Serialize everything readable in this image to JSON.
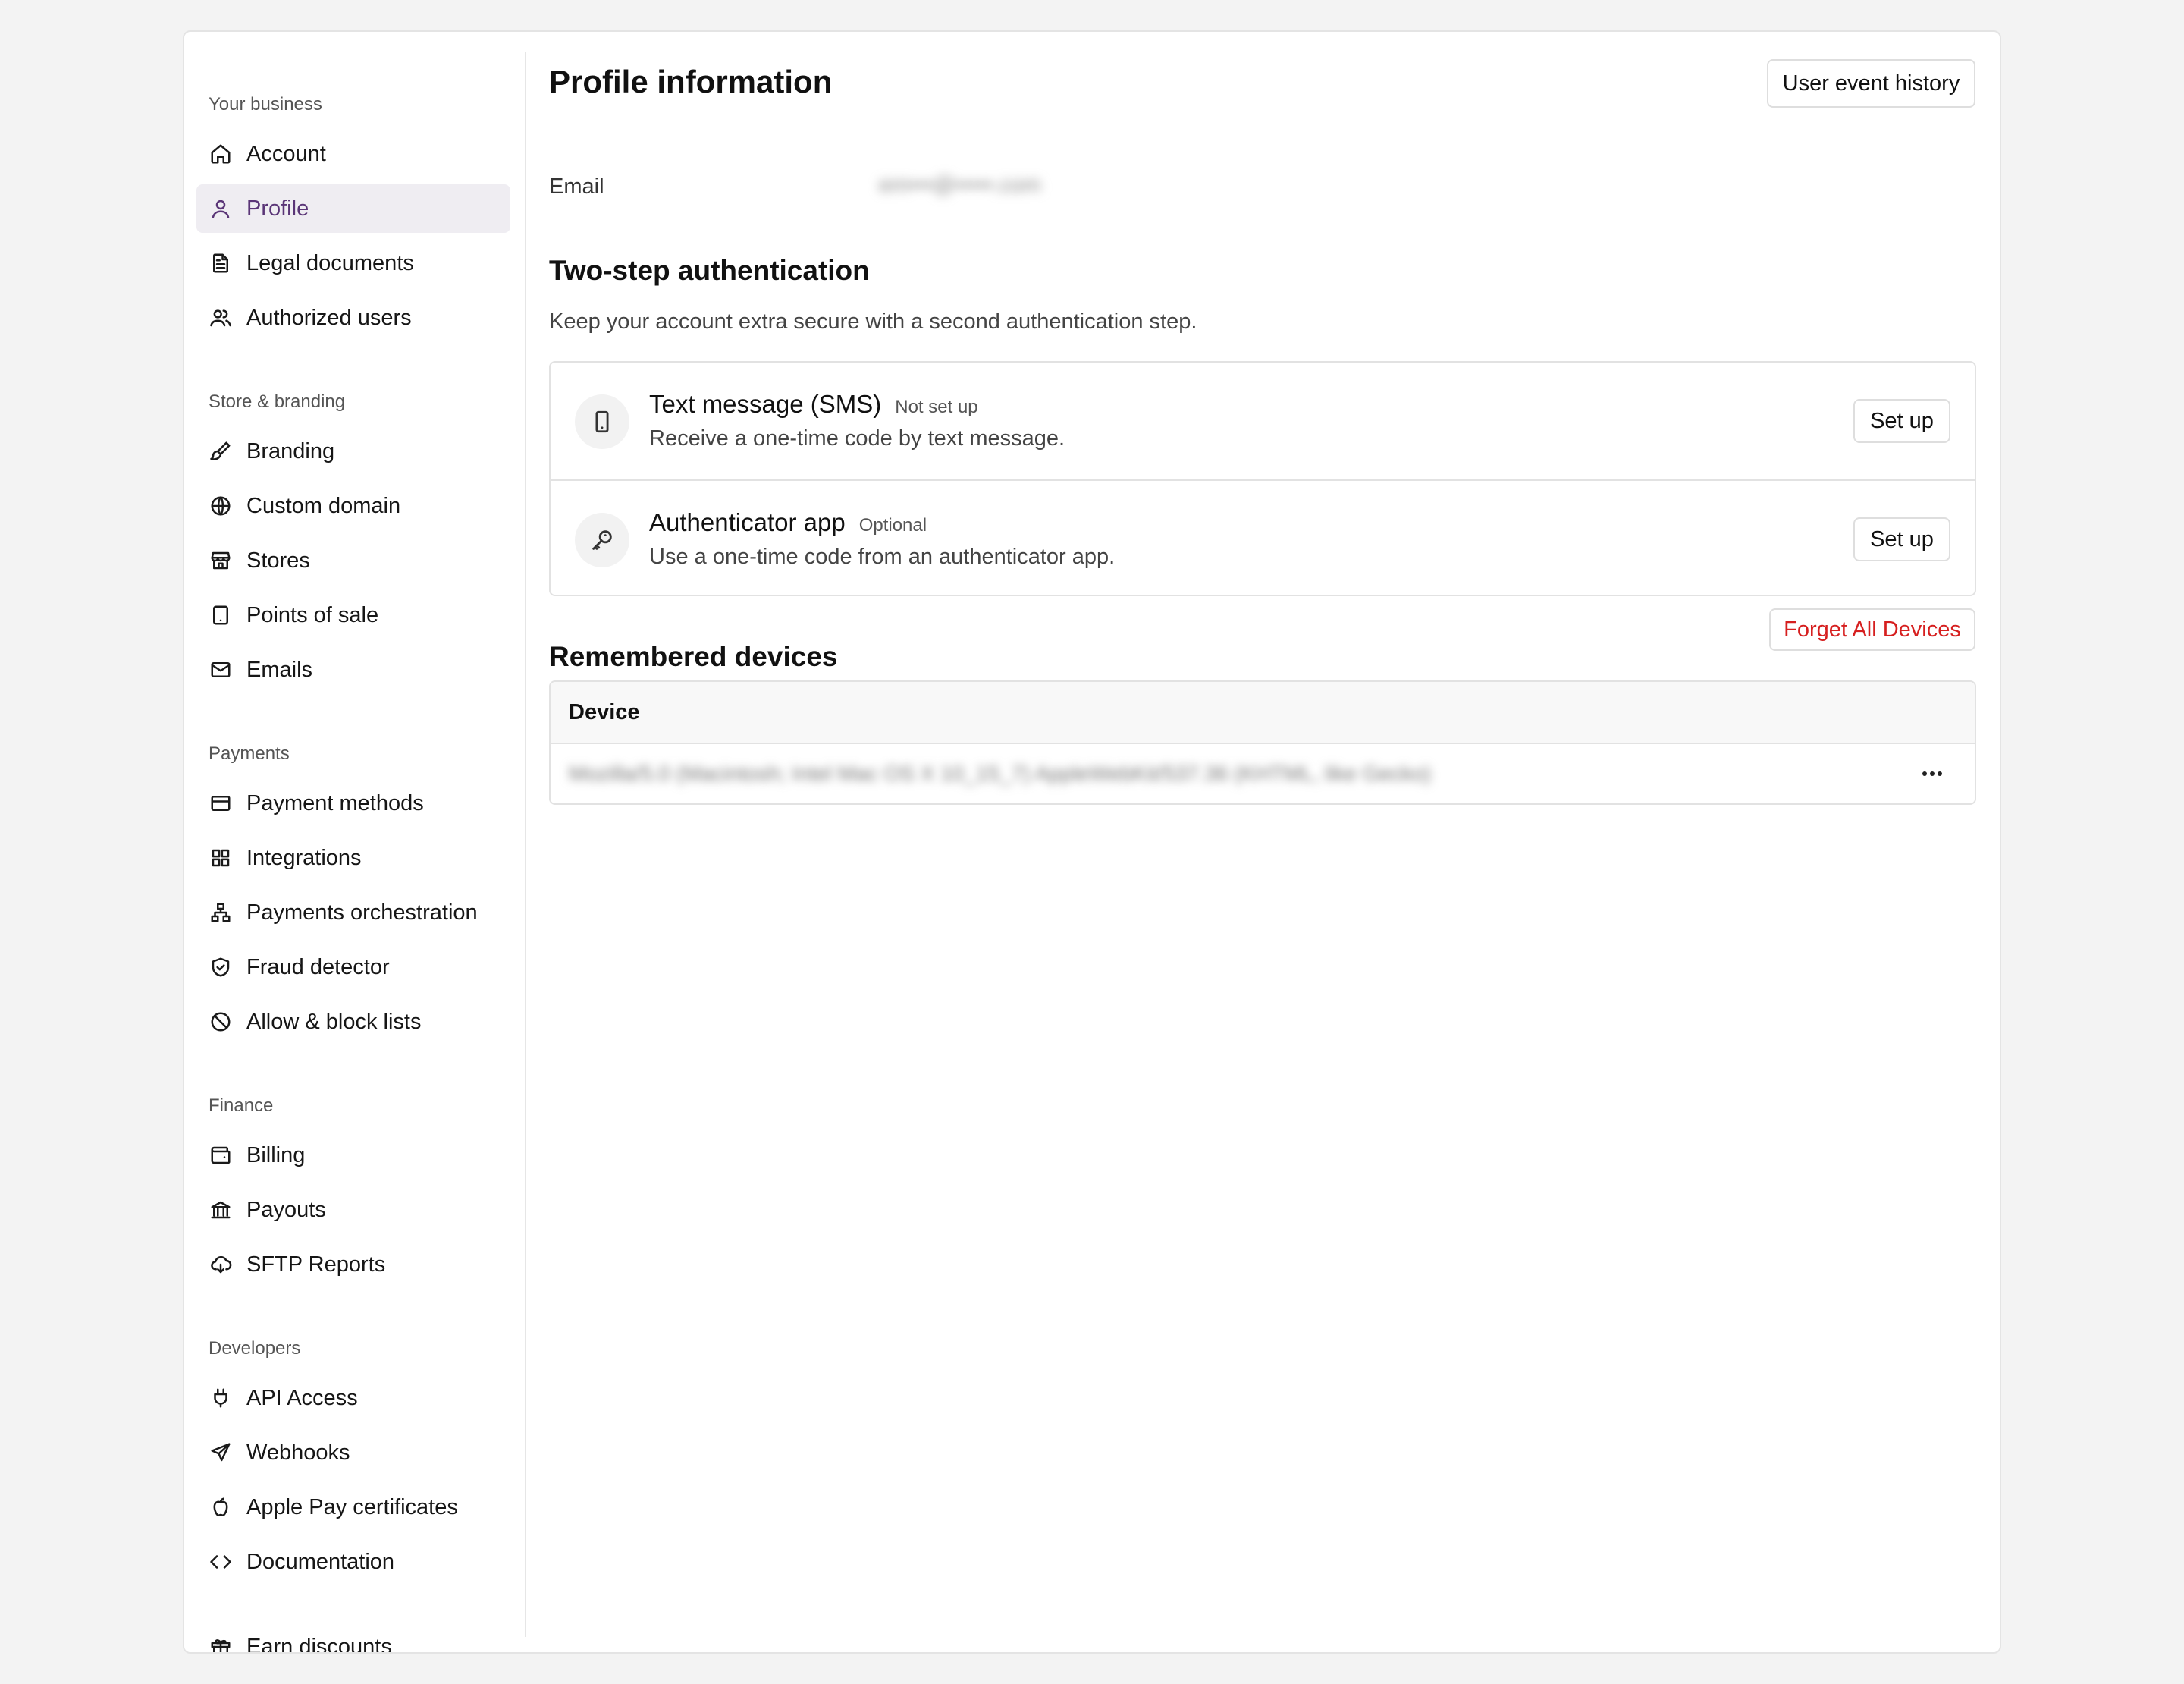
{
  "sidebar": {
    "sections": [
      {
        "title": "Your business",
        "items": [
          {
            "label": "Account",
            "icon": "home-icon"
          },
          {
            "label": "Profile",
            "icon": "user-icon",
            "active": true
          },
          {
            "label": "Legal documents",
            "icon": "document-icon"
          },
          {
            "label": "Authorized users",
            "icon": "users-icon"
          }
        ]
      },
      {
        "title": "Store & branding",
        "items": [
          {
            "label": "Branding",
            "icon": "paintbrush-icon"
          },
          {
            "label": "Custom domain",
            "icon": "globe-icon"
          },
          {
            "label": "Stores",
            "icon": "store-icon"
          },
          {
            "label": "Points of sale",
            "icon": "tablet-icon"
          },
          {
            "label": "Emails",
            "icon": "mail-icon"
          }
        ]
      },
      {
        "title": "Payments",
        "items": [
          {
            "label": "Payment methods",
            "icon": "credit-card-icon"
          },
          {
            "label": "Integrations",
            "icon": "grid-icon"
          },
          {
            "label": "Payments orchestration",
            "icon": "network-icon"
          },
          {
            "label": "Fraud detector",
            "icon": "shield-check-icon"
          },
          {
            "label": "Allow & block lists",
            "icon": "ban-icon"
          }
        ]
      },
      {
        "title": "Finance",
        "items": [
          {
            "label": "Billing",
            "icon": "wallet-icon"
          },
          {
            "label": "Payouts",
            "icon": "bank-icon"
          },
          {
            "label": "SFTP Reports",
            "icon": "cloud-download-icon"
          }
        ]
      },
      {
        "title": "Developers",
        "items": [
          {
            "label": "API Access",
            "icon": "plug-icon"
          },
          {
            "label": "Webhooks",
            "icon": "send-icon"
          },
          {
            "label": "Apple Pay certificates",
            "icon": "apple-icon"
          },
          {
            "label": "Documentation",
            "icon": "code-icon"
          }
        ]
      }
    ],
    "footer_item": {
      "label": "Earn discounts",
      "icon": "gift-icon"
    }
  },
  "main": {
    "title": "Profile information",
    "user_event_history_label": "User event history",
    "email_label": "Email",
    "email_value": "em•••@•••••.com",
    "two_step": {
      "title": "Two-step authentication",
      "description": "Keep your account extra secure with a second authentication step.",
      "methods": [
        {
          "name": "Text message (SMS)",
          "badge": "Not set up",
          "description": "Receive a one-time code by text message.",
          "button": "Set up",
          "icon": "phone-icon"
        },
        {
          "name": "Authenticator app",
          "badge": "Optional",
          "description": "Use a one-time code from an authenticator app.",
          "button": "Set up",
          "icon": "key-icon"
        }
      ]
    },
    "devices": {
      "title": "Remembered devices",
      "forget_all_label": "Forget All Devices",
      "column_device": "Device",
      "rows": [
        {
          "device": "Mozilla/5.0 (Macintosh; Intel Mac OS X 10_15_7) AppleWebKit/537.36 (KHTML, like Gecko)"
        }
      ]
    }
  },
  "colors": {
    "accent": "#5a3577",
    "active_bg": "#efedf2",
    "danger": "#d61f1f",
    "page_bg": "#f3f3f3"
  }
}
